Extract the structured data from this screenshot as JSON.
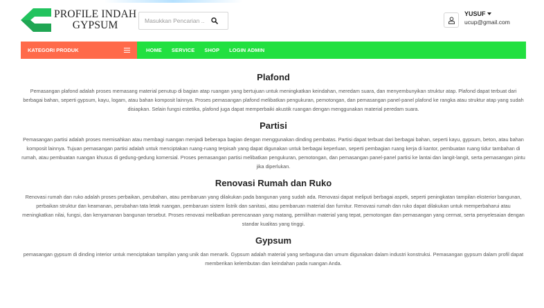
{
  "brand": {
    "line1": "PROFILE INDAH",
    "line2": "GYPSUM",
    "logo_color": "#22c35e"
  },
  "search": {
    "placeholder": "Masukkan Pencarian ..",
    "icon": "search-icon"
  },
  "user": {
    "name": "YUSUF",
    "email": "ucup@gmail.com",
    "icon": "user-icon"
  },
  "nav": {
    "category_label": "KATEGORI PRODUK",
    "category_icon": "hamburger-icon",
    "items": [
      "HOME",
      "SERVICE",
      "SHOP",
      "LOGIN ADMIN"
    ],
    "bar_color": "#22e040",
    "category_color": "#ff6a4a"
  },
  "sections": [
    {
      "title": "Plafond",
      "body": "Pemasangan plafond adalah proses memasang material penutup di bagian atap ruangan yang bertujuan untuk meningkatkan keindahan, meredam suara, dan menyembunyikan struktur atap. Plafond dapat terbuat dari berbagai bahan, seperti gypsum, kayu, logam, atau bahan komposit lainnya. Proses pemasangan plafond melibatkan pengukuran, pemotongan, dan pemasangan panel-panel plafond ke rangka atau struktur atap yang sudah disiapkan. Selain fungsi estetika, plafond juga dapat memperbaiki akustik ruangan dengan menggunakan material peredam suara."
    },
    {
      "title": "Partisi",
      "body": "Pemasangan partisi adalah proses memisahkan atau membagi ruangan menjadi beberapa bagian dengan menggunakan dinding pembatas. Partisi dapat terbuat dari berbagai bahan, seperti kayu, gypsum, beton, atau bahan komposit lainnya. Tujuan pemasangan partisi adalah untuk menciptakan ruang-ruang terpisah yang dapat digunakan untuk berbagai keperluan, seperti pembagian ruang kerja di kantor, pembuatan ruang tidur tambahan di rumah, atau pembuatan ruangan khusus di gedung-gedung komersial. Proses pemasangan partisi melibatkan pengukuran, pemotongan, dan pemasangan panel-panel partisi ke lantai dan langit-langit, serta pemasangan pintu jika diperlukan."
    },
    {
      "title": "Renovasi Rumah dan Ruko",
      "body": "Renovasi rumah dan ruko adalah proses perbaikan, perubahan, atau pembaruan yang dilakukan pada bangunan yang sudah ada. Renovasi dapat meliputi berbagai aspek, seperti peningkatan tampilan eksterior bangunan, perbaikan struktur dan keamanan, perubahan tata letak ruangan, pembaruan sistem listrik dan sanitasi, atau pembaruan material dan furnitur. Renovasi rumah dan ruko dapat dilakukan untuk memperbaharui atau meningkatkan nilai, fungsi, dan kenyamanan bangunan tersebut. Proses renovasi melibatkan perencanaan yang matang, pemilihan material yang tepat, pemotongan dan pemasangan yang cermat, serta penyelesaian dengan standar kualitas yang tinggi."
    },
    {
      "title": "Gypsum",
      "body": "pemasangan gypsum di dinding interior untuk menciptakan tampilan yang unik dan menarik. Gypsum adalah material yang serbaguna dan umum digunakan dalam industri konstruksi. Pemasangan gypsum dalam profil dapat memberikan kelembutan dan keindahan pada ruangan Anda."
    }
  ]
}
